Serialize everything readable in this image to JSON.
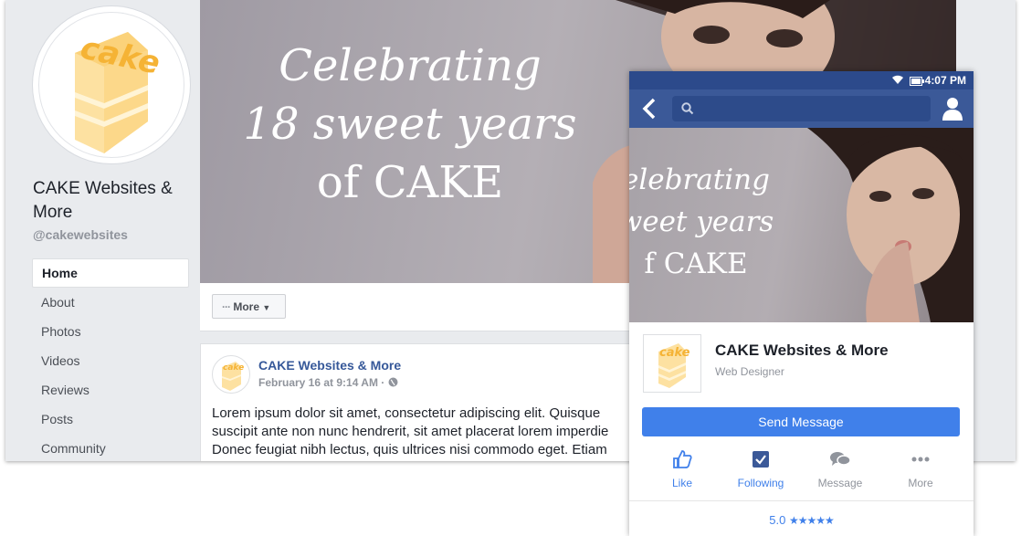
{
  "page": {
    "name": "CAKE Websites & More",
    "handle": "@cakewebsites",
    "logo_text": "cake",
    "brand_color": "#f5b335",
    "cake_color": "#fde1a1"
  },
  "sidebar": {
    "items": [
      {
        "label": "Home",
        "active": true
      },
      {
        "label": "About"
      },
      {
        "label": "Photos"
      },
      {
        "label": "Videos"
      },
      {
        "label": "Reviews"
      },
      {
        "label": "Posts"
      },
      {
        "label": "Community"
      }
    ]
  },
  "cover": {
    "line1": "Celebrating",
    "line2": "18 sweet years",
    "line3": "of CAKE"
  },
  "actionbar": {
    "more_label": "More"
  },
  "post": {
    "author": "CAKE Websites & More",
    "date": "February 16 at 9:14 AM",
    "separator": "·",
    "body_lines": [
      "Lorem ipsum dolor sit amet, consectetur adipiscing elit. Quisque",
      "suscipit ante non nunc hendrerit, sit amet placerat lorem imperdie",
      "Donec feugiat nibh lectus, quis ultrices nisi commodo eget. Etiam"
    ]
  },
  "mobile": {
    "time": "4:07 PM",
    "cover": {
      "line1": "elebrating",
      "line2": "weet years",
      "line3": "f CAKE"
    },
    "page_name": "CAKE Websites & More",
    "category": "Web Designer",
    "send_message": "Send Message",
    "actions": [
      {
        "label": "Like",
        "icon": "thumbs-up-icon",
        "active": true
      },
      {
        "label": "Following",
        "icon": "checkbox-icon",
        "active": true
      },
      {
        "label": "Message",
        "icon": "speech-bubbles-icon",
        "active": false
      },
      {
        "label": "More",
        "icon": "dots-icon",
        "active": false
      }
    ],
    "rating": "5.0",
    "stars": "★★★★★",
    "accent": "#4080ea"
  },
  "colors": {
    "facebook_blue": "#3b5998",
    "link_blue": "#365899",
    "background": "#e9ebee"
  }
}
